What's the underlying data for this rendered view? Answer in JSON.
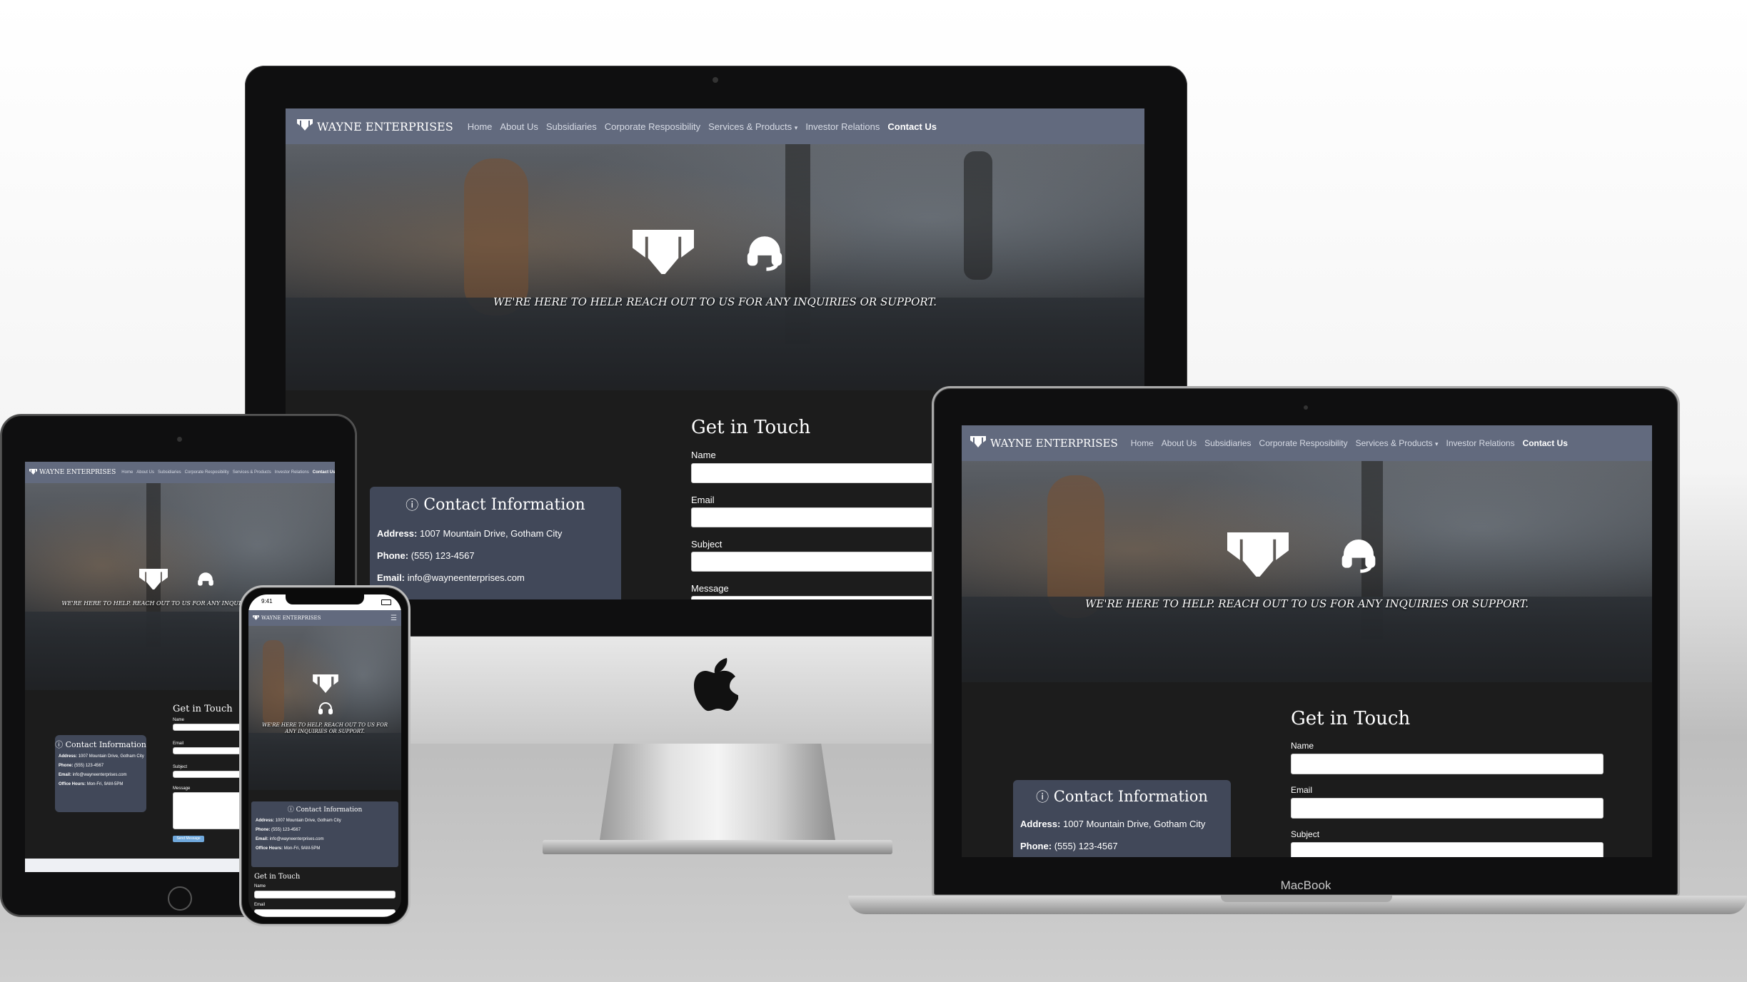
{
  "site": {
    "brand": "WAYNE ENTERPRISES",
    "nav": [
      "Home",
      "About Us",
      "Subsidiaries",
      "Corporate Resposibility",
      "Services & Products",
      "Investor Relations",
      "Contact Us"
    ],
    "active_nav": "Contact Us",
    "tagline": "WE'RE HERE TO HELP. REACH OUT TO US FOR ANY INQUIRIES OR SUPPORT.",
    "contact_title": "Contact Information",
    "address_label": "Address:",
    "address_value": "1007 Mountain Drive, Gotham City",
    "phone_label": "Phone:",
    "phone_value": "(555) 123-4567",
    "email_label": "Email:",
    "email_value": "info@wayneenterprises.com",
    "hours_label": "Office Hours:",
    "hours_value": "Mon-Fri, 9AM-5PM",
    "form_title": "Get in Touch",
    "fields": [
      "Name",
      "Email",
      "Subject",
      "Message"
    ],
    "submit_label": "Send Message"
  },
  "devices": {
    "laptop_label": "MacBook",
    "phone_time": "9:41"
  },
  "colors": {
    "navbar": "#626a7e",
    "page_bg": "#1c1c1c",
    "card_bg": "#414859",
    "button": "#6fa8dc"
  },
  "icons": [
    "wayne-logo-icon",
    "headset-icon",
    "info-icon",
    "apple-logo-icon",
    "dropdown-caret-icon",
    "hamburger-menu-icon"
  ]
}
